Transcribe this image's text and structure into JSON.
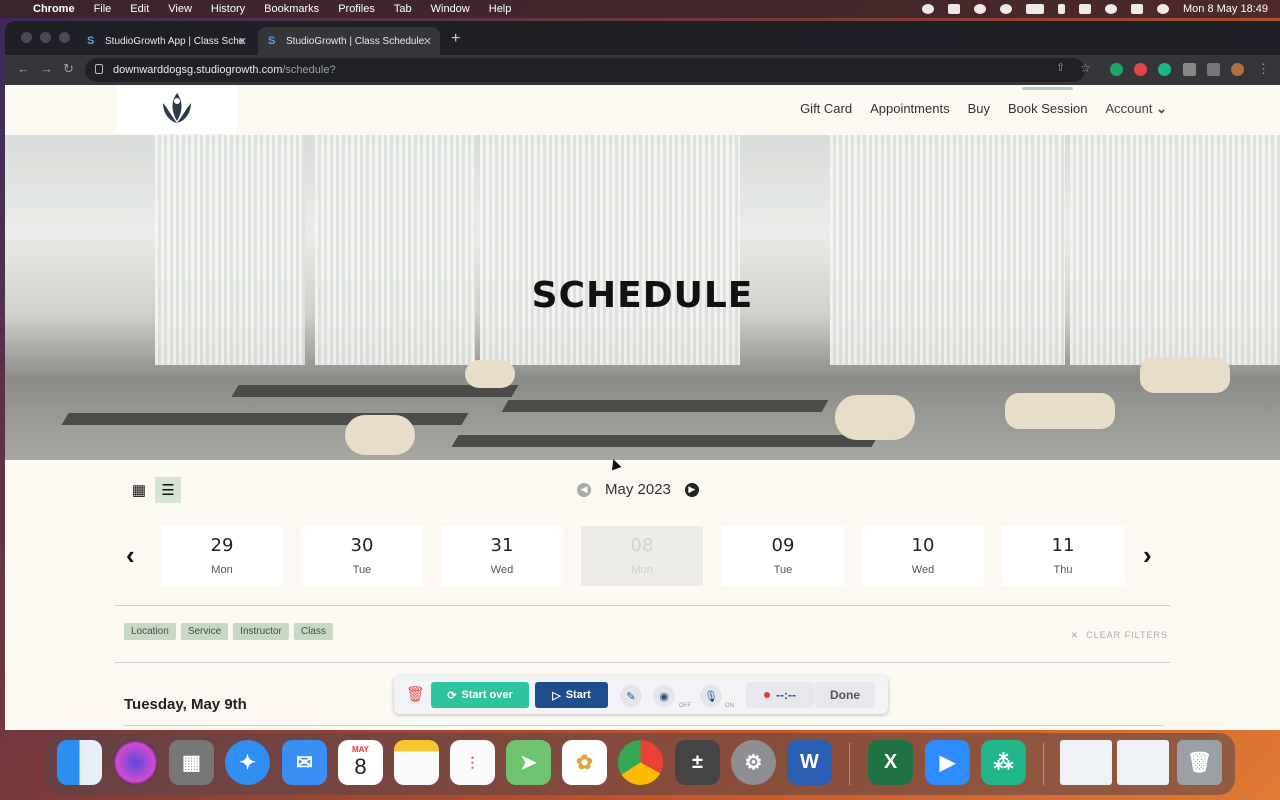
{
  "menubar": {
    "apple": "",
    "app": "Chrome",
    "items": [
      "File",
      "Edit",
      "View",
      "History",
      "Bookmarks",
      "Profiles",
      "Tab",
      "Window",
      "Help"
    ],
    "clock": "Mon 8 May  18:49"
  },
  "browser": {
    "tabs": [
      {
        "title": "StudioGrowth App | Class Sche"
      },
      {
        "title": "StudioGrowth | Class Schedule"
      }
    ],
    "url_host": "downwarddogsg.studiogrowth.com",
    "url_path": "/schedule?"
  },
  "site": {
    "nav": [
      "Gift Card",
      "Appointments",
      "Buy",
      "Book Session"
    ],
    "account": "Account",
    "hero_title": "SCHEDULE"
  },
  "schedule": {
    "month": "May 2023",
    "days": [
      {
        "num": "29",
        "dow": "Mon",
        "selected": false
      },
      {
        "num": "30",
        "dow": "Tue",
        "selected": false
      },
      {
        "num": "31",
        "dow": "Wed",
        "selected": false
      },
      {
        "num": "08",
        "dow": "Mon",
        "selected": true
      },
      {
        "num": "09",
        "dow": "Tue",
        "selected": false
      },
      {
        "num": "10",
        "dow": "Wed",
        "selected": false
      },
      {
        "num": "11",
        "dow": "Thu",
        "selected": false
      }
    ],
    "filters": [
      "Location",
      "Service",
      "Instructor",
      "Class"
    ],
    "clear_filters": "CLEAR FILTERS",
    "day_heading": "Tuesday, May 9th"
  },
  "recorder": {
    "start_over": "Start over",
    "start": "Start",
    "cam_state": "OFF",
    "mic_state": "ON",
    "timer": "--:--",
    "done": "Done"
  },
  "dock": {
    "calendar_month": "MAY",
    "calendar_day": "8"
  },
  "colors": {
    "accent_green": "#2ec4a0",
    "accent_blue": "#1e4f8c",
    "chip_green": "#c7d8c4",
    "page_bg": "#fbf9f2"
  }
}
